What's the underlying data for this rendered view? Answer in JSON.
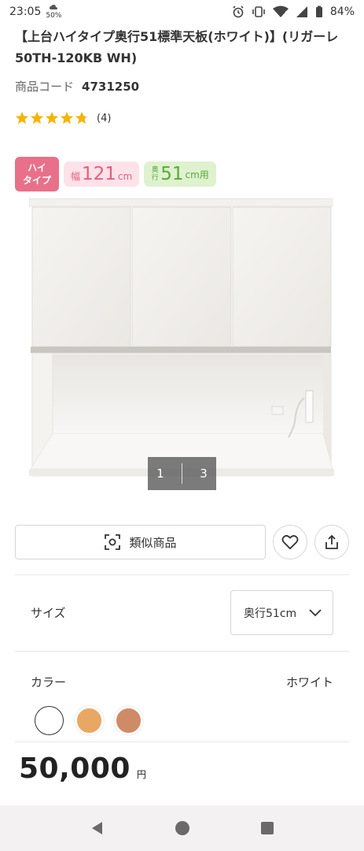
{
  "status_bar": {
    "time": "23:05",
    "battery_saver": "50%",
    "battery_percent": "84%"
  },
  "product": {
    "title": "【上台ハイタイプ奥行51標準天板(ホワイト)】(リガーレ50TH-120KB WH)",
    "code_label": "商品コード",
    "code_value": "4731250",
    "rating": 4.8,
    "review_count": "(4)"
  },
  "badges": {
    "type_line1": "ハイ",
    "type_line2": "タイプ",
    "width_label": "幅",
    "width_value": "121",
    "width_unit": "cm",
    "depth_label": "奥行",
    "depth_value": "51",
    "depth_unit": "cm用"
  },
  "gallery": {
    "current": "1",
    "total": "3"
  },
  "actions": {
    "similar_label": "類似商品"
  },
  "options": {
    "size_label": "サイズ",
    "size_value": "奥行51cm",
    "color_label": "カラー",
    "color_value": "ホワイト",
    "swatches": [
      "#ffffff",
      "#e9a764",
      "#cf8b66"
    ]
  },
  "price": {
    "value": "50,000",
    "currency": "円"
  },
  "colors": {
    "badge_pink": "#e8708a",
    "badge_width_bg": "#fde2ea",
    "badge_depth_bg": "#dff2cf",
    "star": "#f5b400"
  }
}
